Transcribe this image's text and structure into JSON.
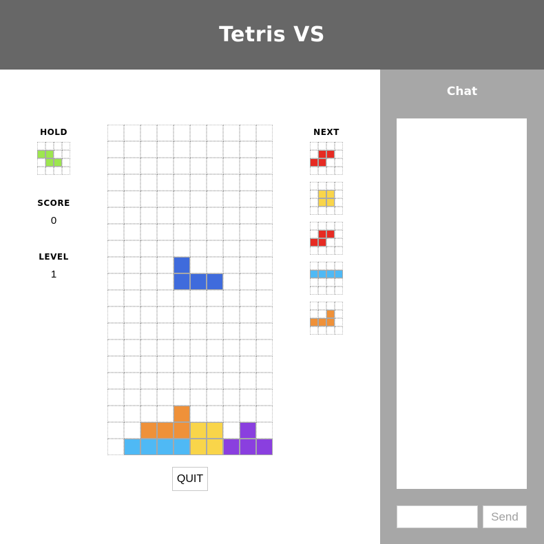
{
  "header": {
    "title": "Tetris VS"
  },
  "left_panel": {
    "hold_label": "HOLD",
    "score_label": "SCORE",
    "score_value": "0",
    "level_label": "LEVEL",
    "level_value": "1"
  },
  "next_label": "NEXT",
  "colors": {
    "I": "#4fb9f5",
    "O": "#f9d54a",
    "T": "#8a3fdf",
    "S": "#9de64f",
    "Z": "#e62b23",
    "J": "#3f6bdc",
    "L": "#ef9139"
  },
  "board": {
    "columns": 10,
    "rows": 20,
    "active_piece": {
      "type": "J",
      "cells": [
        [
          4,
          8
        ],
        [
          4,
          9
        ],
        [
          5,
          9
        ],
        [
          6,
          9
        ]
      ]
    },
    "locked_cells": [
      {
        "col": 4,
        "row": 17,
        "color": "L"
      },
      {
        "col": 2,
        "row": 18,
        "color": "L"
      },
      {
        "col": 3,
        "row": 18,
        "color": "L"
      },
      {
        "col": 4,
        "row": 18,
        "color": "L"
      },
      {
        "col": 5,
        "row": 18,
        "color": "O"
      },
      {
        "col": 6,
        "row": 18,
        "color": "O"
      },
      {
        "col": 8,
        "row": 18,
        "color": "T"
      },
      {
        "col": 1,
        "row": 19,
        "color": "I"
      },
      {
        "col": 2,
        "row": 19,
        "color": "I"
      },
      {
        "col": 3,
        "row": 19,
        "color": "I"
      },
      {
        "col": 4,
        "row": 19,
        "color": "I"
      },
      {
        "col": 5,
        "row": 19,
        "color": "O"
      },
      {
        "col": 6,
        "row": 19,
        "color": "O"
      },
      {
        "col": 7,
        "row": 19,
        "color": "T"
      },
      {
        "col": 8,
        "row": 19,
        "color": "T"
      },
      {
        "col": 9,
        "row": 19,
        "color": "T"
      }
    ]
  },
  "hold_piece": {
    "type": "Z",
    "color": "S",
    "cells": [
      [
        0,
        1
      ],
      [
        1,
        1
      ],
      [
        1,
        2
      ],
      [
        2,
        2
      ]
    ]
  },
  "next_queue": [
    {
      "type": "S",
      "color": "Z",
      "cells": [
        [
          1,
          1
        ],
        [
          2,
          1
        ],
        [
          0,
          2
        ],
        [
          1,
          2
        ]
      ]
    },
    {
      "type": "O",
      "color": "O",
      "cells": [
        [
          1,
          1
        ],
        [
          2,
          1
        ],
        [
          1,
          2
        ],
        [
          2,
          2
        ]
      ]
    },
    {
      "type": "S",
      "color": "Z",
      "cells": [
        [
          1,
          1
        ],
        [
          2,
          1
        ],
        [
          0,
          2
        ],
        [
          1,
          2
        ]
      ]
    },
    {
      "type": "I",
      "color": "I",
      "cells": [
        [
          0,
          1
        ],
        [
          1,
          1
        ],
        [
          2,
          1
        ],
        [
          3,
          1
        ]
      ]
    },
    {
      "type": "L",
      "color": "L",
      "cells": [
        [
          2,
          1
        ],
        [
          0,
          2
        ],
        [
          1,
          2
        ],
        [
          2,
          2
        ]
      ]
    }
  ],
  "quit_label": "QUIT",
  "chat": {
    "title": "Chat",
    "input_value": "",
    "send_label": "Send"
  }
}
